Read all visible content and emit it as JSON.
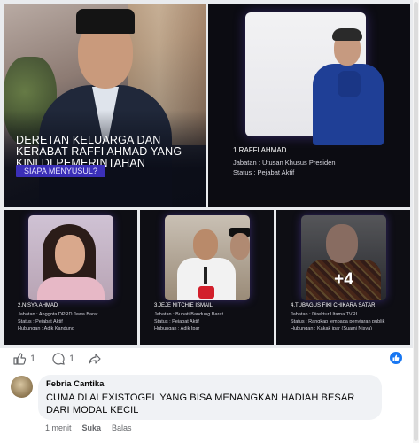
{
  "post": {
    "main_card": {
      "title": "DERETAN KELUARGA DAN KERABAT RAFFI AHMAD YANG KINI DI PEMERINTAHAN",
      "button": "SIAPA MENYUSUL?"
    },
    "cards": [
      {
        "name": "1.RAFFI AHMAD",
        "line1": "Jabatan : Utusan Khusus Presiden",
        "line2": "Status    : Pejabat Aktif",
        "line3": ""
      },
      {
        "name": "2.NISYA AHMAD",
        "line1": "Jabatan   : Anggota DPRD Jawa Barat",
        "line2": "Status     : Pejabat Aktif",
        "line3": "Hubungan : Adik Kandung"
      },
      {
        "name": "3.JEJE NITCHIE ISMAIL",
        "line1": "Jabatan   : Bupati Bandung Barat",
        "line2": "Status     : Pejabat Aktif",
        "line3": "Hubungan : Adik Ipar"
      },
      {
        "name": "4.TUBAGUS FIKI CHIKARA SATARI",
        "line1": "Jabatan   : Direktur Utama TVRI",
        "line2": "Status     : Rangkap lembaga penyiaran publik",
        "line3": "Hubungan : Kakak ipar (Suami Nisya)"
      }
    ],
    "more_count": "+4"
  },
  "reactions": {
    "like_count": "1",
    "comment_count": "1",
    "like_icon": "thumbs-up-icon",
    "comment_icon": "speech-bubble-icon",
    "share_icon": "share-arrow-icon",
    "accent": "#1877f2"
  },
  "comment": {
    "author": "Febria Cantika",
    "text": "CUMA DI ALEXISTOGEL YANG BISA MENANGKAN HADIAH BESAR DARI MODAL KECIL",
    "time": "1 menit",
    "like_action": "Suka",
    "reply_action": "Balas"
  }
}
